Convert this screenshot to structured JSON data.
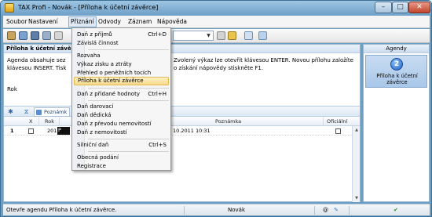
{
  "window": {
    "title": "TAX Profi - Novák - [Příloha k účetní závěrce]"
  },
  "menubar": [
    "Soubor",
    "Nastavení",
    "Přiznání",
    "Odvody",
    "Záznam",
    "Nápověda"
  ],
  "info_panel": {
    "header": "Příloha k účetní závě",
    "line1_left": "Agenda obsahuje sez",
    "line1_right": "Zvolený výkaz lze otevřít klávesou ENTER. Novou přílohu založíte",
    "line2_left": "klávesou INSERT. Tisk",
    "line2_right": "o získání nápovědy stiskněte F1.",
    "rok_label": "Rok"
  },
  "grid_toolbar": {
    "tab_label": "Poznámk"
  },
  "grid": {
    "columns": [
      "X",
      "Rok",
      "Poznámka",
      "Oficiální"
    ],
    "rows": [
      {
        "num": "1",
        "rok": "2011",
        "sel": "P",
        "date": "10.2011 10:31"
      }
    ]
  },
  "agendy": {
    "title": "Agendy",
    "item_label": "Příloha k účetní závěrce"
  },
  "statusbar": {
    "left": "Otevře agendu Příloha k účetní závěrce.",
    "user": "Novák"
  },
  "dropdown": {
    "items": [
      {
        "label": "Daň z příjmů",
        "shortcut": "Ctrl+D"
      },
      {
        "label": "Závislá činnost",
        "shortcut": ""
      },
      {
        "label": "Rozvaha",
        "shortcut": ""
      },
      {
        "label": "Výkaz zisku a ztráty",
        "shortcut": ""
      },
      {
        "label": "Přehled o peněžních tocích",
        "shortcut": ""
      },
      {
        "label": "Příloha k účetní závěrce",
        "shortcut": ""
      },
      {
        "label": "Daň z přidané hodnoty",
        "shortcut": "Ctrl+H"
      },
      {
        "label": "Daň darovací",
        "shortcut": ""
      },
      {
        "label": "Daň dědická",
        "shortcut": ""
      },
      {
        "label": "Daň z převodu nemovitostí",
        "shortcut": ""
      },
      {
        "label": "Daň z nemovitostí",
        "shortcut": ""
      },
      {
        "label": "Silniční daň",
        "shortcut": "Ctrl+S"
      },
      {
        "label": "Obecná podání",
        "shortcut": ""
      },
      {
        "label": "Registrace",
        "shortcut": ""
      }
    ]
  },
  "colors": {
    "accent": "#6aa0c6",
    "highlight": "#f8d98a"
  }
}
